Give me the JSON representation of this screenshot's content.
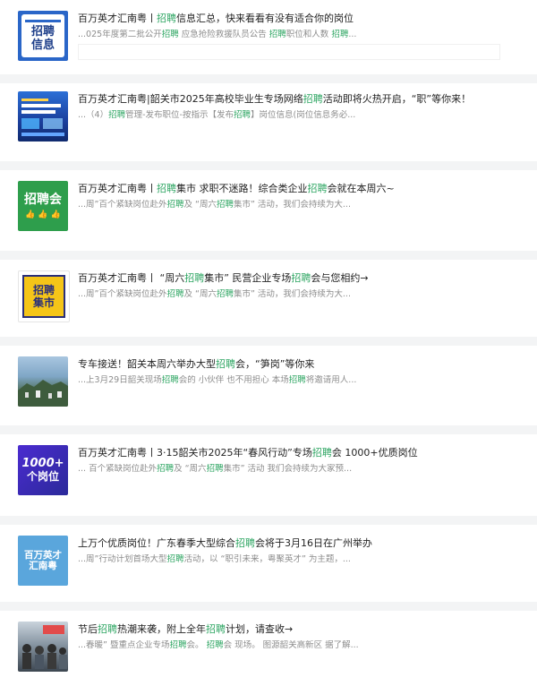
{
  "items": [
    {
      "thumb": {
        "icon": "recruit-info-icon",
        "lines": [
          "招聘",
          "信息"
        ],
        "bg": "#2a66c8"
      },
      "title": [
        {
          "t": "百万英才汇南粤丨"
        },
        {
          "t": "招聘",
          "h": true
        },
        {
          "t": "信息汇总，快来看看有没有适合你的岗位"
        }
      ],
      "snippet": [
        {
          "t": "...025年度第二批公开"
        },
        {
          "t": "招聘",
          "h": true
        },
        {
          "t": " 应急抢险救援队员公告 "
        },
        {
          "t": "招聘",
          "h": true
        },
        {
          "t": "职位和人数 "
        },
        {
          "t": "招聘",
          "h": true
        },
        {
          "t": "..."
        }
      ]
    },
    {
      "thumb": {
        "icon": "job-fair-banner-icon",
        "lines": [],
        "bg": "#1d4fb3"
      },
      "title": [
        {
          "t": "百万英才汇南粤|韶关市2025年高校毕业生专场网络"
        },
        {
          "t": "招聘",
          "h": true
        },
        {
          "t": "活动即将火热开启，“职”等你来！"
        }
      ],
      "snippet": [
        {
          "t": "...（4）"
        },
        {
          "t": "招聘",
          "h": true
        },
        {
          "t": "管理-发布职位-按指示【发布"
        },
        {
          "t": "招聘",
          "h": true
        },
        {
          "t": "】岗位信息(岗位信息务必..."
        }
      ]
    },
    {
      "thumb": {
        "icon": "job-fair-icon",
        "lines": [
          "招聘会"
        ],
        "bg": "#2e9e4c"
      },
      "title": [
        {
          "t": "百万英才汇南粤丨"
        },
        {
          "t": "招聘",
          "h": true
        },
        {
          "t": "集市 求职不迷路！综合类企业"
        },
        {
          "t": "招聘",
          "h": true
        },
        {
          "t": "会就在本周六~"
        }
      ],
      "snippet": [
        {
          "t": "...周”百个紧缺岗位赴外"
        },
        {
          "t": "招聘",
          "h": true
        },
        {
          "t": "及 “周六"
        },
        {
          "t": "招聘",
          "h": true
        },
        {
          "t": "集市” 活动，我们会持续为大..."
        }
      ]
    },
    {
      "thumb": {
        "icon": "recruit-market-icon",
        "lines": [
          "招聘",
          "集市"
        ],
        "bg": "#ffffff"
      },
      "title": [
        {
          "t": "百万英才汇南粤丨 “周六"
        },
        {
          "t": "招聘",
          "h": true
        },
        {
          "t": "集市” 民营企业专场"
        },
        {
          "t": "招聘",
          "h": true
        },
        {
          "t": "会与您相约→"
        }
      ],
      "snippet": [
        {
          "t": "...周”百个紧缺岗位赴外"
        },
        {
          "t": "招聘",
          "h": true
        },
        {
          "t": "及 “周六"
        },
        {
          "t": "招聘",
          "h": true
        },
        {
          "t": "集市” 活动，我们会持续为大..."
        }
      ]
    },
    {
      "thumb": {
        "icon": "city-photo-icon",
        "lines": [],
        "bg": "#6b8fb0"
      },
      "title": [
        {
          "t": "专车接送！韶关本周六举办大型"
        },
        {
          "t": "招聘",
          "h": true
        },
        {
          "t": "会，“笋岗”等你来"
        }
      ],
      "snippet": [
        {
          "t": "...上3月29日韶关现场"
        },
        {
          "t": "招聘",
          "h": true
        },
        {
          "t": "会的 小伙伴 也不用担心 本场"
        },
        {
          "t": "招聘",
          "h": true
        },
        {
          "t": "将邀请用人..."
        }
      ]
    },
    {
      "thumb": {
        "icon": "thousand-jobs-icon",
        "lines": [
          "1000+",
          "个岗位"
        ],
        "bg": "#3b2fb0"
      },
      "title": [
        {
          "t": "百万英才汇南粤丨3·15韶关市2025年“春风行动”专场"
        },
        {
          "t": "招聘",
          "h": true
        },
        {
          "t": "会 1000+优质岗位"
        }
      ],
      "snippet": [
        {
          "t": "... 百个紧缺岗位赴外"
        },
        {
          "t": "招聘",
          "h": true
        },
        {
          "t": "及 “周六"
        },
        {
          "t": "招聘",
          "h": true
        },
        {
          "t": "集市” 活动 我们会持续为大家预..."
        }
      ]
    },
    {
      "thumb": {
        "icon": "talent-guangdong-icon",
        "lines": [
          "百万英才",
          "汇南粤"
        ],
        "bg": "#5aa6dc"
      },
      "title": [
        {
          "t": "上万个优质岗位！广东春季大型综合"
        },
        {
          "t": "招聘",
          "h": true
        },
        {
          "t": "会将于3月16日在广州举办"
        }
      ],
      "snippet": [
        {
          "t": "...周”行动计划首场大型"
        },
        {
          "t": "招聘",
          "h": true
        },
        {
          "t": "活动，以 “职引未来，粤聚英才” 为主题，..."
        }
      ]
    },
    {
      "thumb": {
        "icon": "crowd-photo-icon",
        "lines": [],
        "bg": "#7f8c99"
      },
      "title": [
        {
          "t": "节后"
        },
        {
          "t": "招聘",
          "h": true
        },
        {
          "t": "热潮来袭，附上全年"
        },
        {
          "t": "招聘",
          "h": true
        },
        {
          "t": "计划，请查收→"
        }
      ],
      "snippet": [
        {
          "t": "...春暖” 暨重点企业专场"
        },
        {
          "t": "招聘",
          "h": true
        },
        {
          "t": "会。 "
        },
        {
          "t": "招聘",
          "h": true
        },
        {
          "t": "会 现场。 图源韶关高新区 据了解..."
        }
      ]
    }
  ]
}
